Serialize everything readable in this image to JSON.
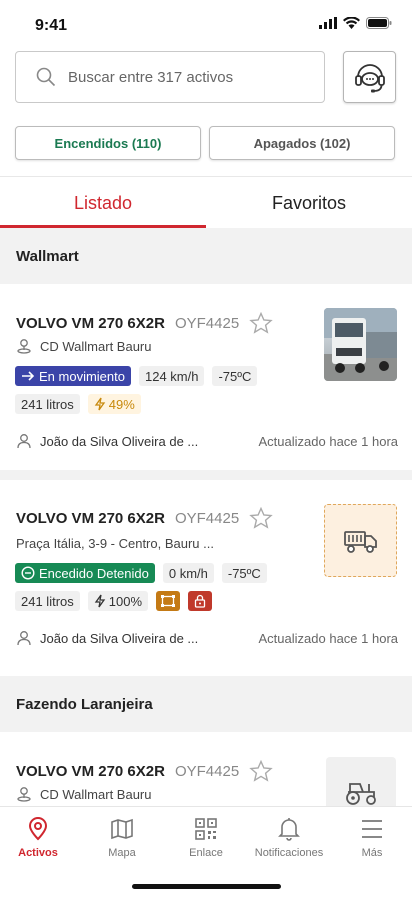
{
  "status_bar": {
    "time": "9:41"
  },
  "search": {
    "placeholder": "Buscar entre 317 activos"
  },
  "filters": {
    "on_label": "Encendidos (110)",
    "off_label": "Apagados (102)"
  },
  "tabs": {
    "list": "Listado",
    "favorites": "Favoritos"
  },
  "groups": [
    {
      "name": "Wallmart"
    },
    {
      "name": "Fazendo Laranjeira"
    }
  ],
  "cards": [
    {
      "title": "VOLVO VM 270 6X2R",
      "plate": "OYF4425",
      "location": "CD Wallmart Bauru",
      "status": "En movimiento",
      "speed": "124 km/h",
      "temp": "-75ºC",
      "fuel": "241 litros",
      "battery": "49%",
      "driver": "João da Silva Oliveira de ...",
      "updated": "Actualizado hace 1 hora"
    },
    {
      "title": "VOLVO VM 270 6X2R",
      "plate": "OYF4425",
      "location": "Praça Itália, 3-9 - Centro, Bauru ...",
      "status": "Encedido Detenido",
      "speed": "0 km/h",
      "temp": "-75ºC",
      "fuel": "241 litros",
      "battery": "100%",
      "driver": "João da Silva Oliveira de ...",
      "updated": "Actualizado hace 1 hora"
    },
    {
      "title": "VOLVO VM 270 6X2R",
      "plate": "OYF4425",
      "location": "CD Wallmart Bauru"
    }
  ],
  "nav": [
    {
      "label": "Activos",
      "icon": "location-pin-icon",
      "active": true
    },
    {
      "label": "Mapa",
      "icon": "map-icon"
    },
    {
      "label": "Enlace",
      "icon": "qr-code-icon"
    },
    {
      "label": "Notificaciones",
      "icon": "bell-icon"
    },
    {
      "label": "Más",
      "icon": "menu-icon"
    }
  ],
  "colors": {
    "accent": "#d0272f",
    "moving": "#3b44a8",
    "stopped": "#178a55",
    "on_filter": "#1b7a52"
  }
}
